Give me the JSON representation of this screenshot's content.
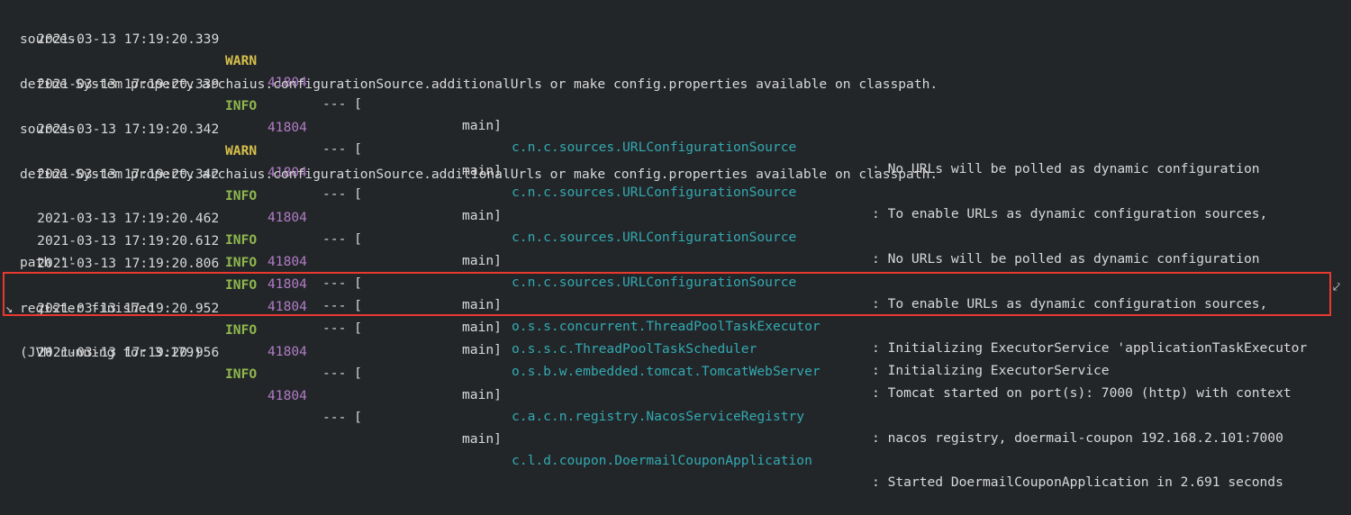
{
  "clipped_top_text": "-------",
  "log_lines": [
    {
      "ts": "2021-03-13 17:19:20.339",
      "level": "WARN",
      "pid": "41804",
      "sep": "--- [",
      "thread": "main]",
      "logger": "c.n.c.sources.URLConfigurationSource",
      "message": ": No URLs will be polled as dynamic configuration",
      "cont": "sources."
    },
    {
      "ts": "2021-03-13 17:19:20.339",
      "level": "INFO",
      "pid": "41804",
      "sep": "--- [",
      "thread": "main]",
      "logger": "c.n.c.sources.URLConfigurationSource",
      "message": ": To enable URLs as dynamic configuration sources,",
      "cont": "define System property archaius.configurationSource.additionalUrls or make config.properties available on classpath."
    },
    {
      "ts": "2021-03-13 17:19:20.342",
      "level": "WARN",
      "pid": "41804",
      "sep": "--- [",
      "thread": "main]",
      "logger": "c.n.c.sources.URLConfigurationSource",
      "message": ": No URLs will be polled as dynamic configuration",
      "cont": "sources."
    },
    {
      "ts": "2021-03-13 17:19:20.342",
      "level": "INFO",
      "pid": "41804",
      "sep": "--- [",
      "thread": "main]",
      "logger": "c.n.c.sources.URLConfigurationSource",
      "message": ": To enable URLs as dynamic configuration sources,",
      "cont": "define System property archaius.configurationSource.additionalUrls or make config.properties available on classpath."
    },
    {
      "ts": "2021-03-13 17:19:20.462",
      "level": "INFO",
      "pid": "41804",
      "sep": "--- [",
      "thread": "main]",
      "logger": "o.s.s.concurrent.ThreadPoolTaskExecutor",
      "message": ": Initializing ExecutorService 'applicationTaskExecutor",
      "cont": ""
    },
    {
      "ts": "2021-03-13 17:19:20.612",
      "level": "INFO",
      "pid": "41804",
      "sep": "--- [",
      "thread": "main]",
      "logger": "o.s.s.c.ThreadPoolTaskScheduler",
      "message": ": Initializing ExecutorService",
      "cont": ""
    },
    {
      "ts": "2021-03-13 17:19:20.806",
      "level": "INFO",
      "pid": "41804",
      "sep": "--- [",
      "thread": "main]",
      "logger": "o.s.b.w.embedded.tomcat.TomcatWebServer",
      "message": ": Tomcat started on port(s): 7000 (http) with context",
      "cont": "path ''"
    },
    {
      "ts": "2021-03-13 17:19:20.952",
      "level": "INFO",
      "pid": "41804",
      "sep": "--- [",
      "thread": "main]",
      "logger": "c.a.c.n.registry.NacosServiceRegistry",
      "message": ": nacos registry, doermail-coupon 192.168.2.101:7000",
      "cont": "register finished"
    },
    {
      "ts": "2021-03-13 17:19:20.956",
      "level": "INFO",
      "pid": "41804",
      "sep": "--- [",
      "thread": "main]",
      "logger": "c.l.d.coupon.DoermailCouponApplication",
      "message": ": Started DoermailCouponApplication in 2.691 seconds",
      "cont": "(JVM running for 3.179)"
    }
  ],
  "colors": {
    "background": "#232629",
    "warn": "#d6c04a",
    "info": "#8fb84e",
    "pid": "#b07cc6",
    "logger": "#32aab2",
    "highlight": "#e8392e"
  }
}
